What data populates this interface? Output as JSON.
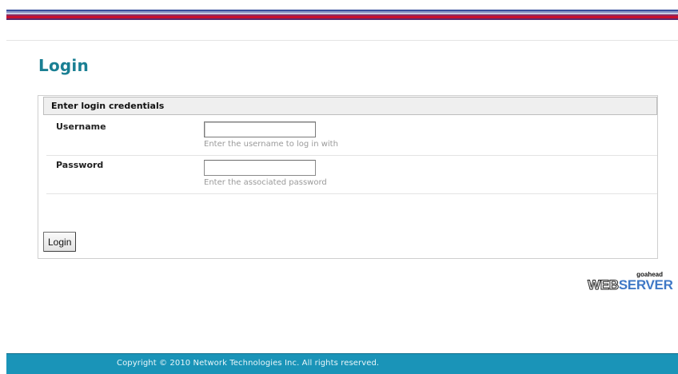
{
  "page": {
    "title": "Login"
  },
  "panel": {
    "header": "Enter login credentials",
    "username": {
      "label": "Username",
      "value": "",
      "hint": "Enter the username to log in with"
    },
    "password": {
      "label": "Password",
      "value": "",
      "hint": "Enter the associated password"
    },
    "login_button": "Login"
  },
  "logo": {
    "small": "goahead",
    "web": "WEB",
    "server": "SERVER"
  },
  "footer": {
    "copyright": "Copyright © 2010 Network Technologies Inc. All rights reserved."
  },
  "colors": {
    "title": "#1a7f93",
    "footer_bg": "#1a94b8",
    "top_bar_red": "#c8102e",
    "top_bar_blue": "#3a4f9e"
  },
  "icons": {
    "header_decoration": "striped-color-bar"
  }
}
